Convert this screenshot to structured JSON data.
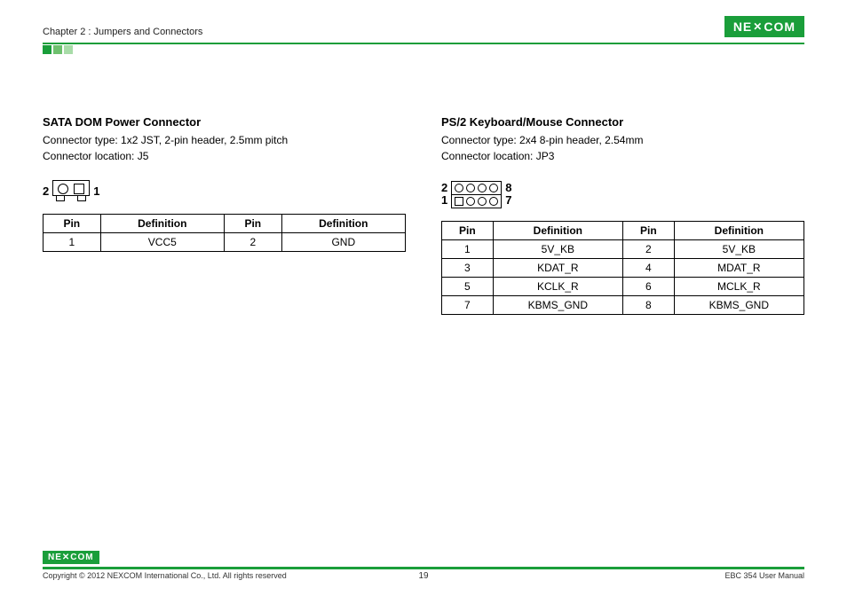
{
  "header": {
    "chapter": "Chapter 2 : Jumpers and Connectors",
    "logo": "NE✕COM"
  },
  "left": {
    "title": "SATA DOM Power Connector",
    "type_line": "Connector type: 1x2 JST, 2-pin header, 2.5mm pitch",
    "loc_line": "Connector location: J5",
    "diag_left_label": "2",
    "diag_right_label": "1",
    "th_pin": "Pin",
    "th_def": "Definition",
    "rows": [
      {
        "p1": "1",
        "d1": "VCC5",
        "p2": "2",
        "d2": "GND"
      }
    ]
  },
  "right": {
    "title": "PS/2 Keyboard/Mouse Connector",
    "type_line": "Connector type: 2x4 8-pin header, 2.54mm",
    "loc_line": "Connector location: JP3",
    "label_top_left": "2",
    "label_bot_left": "1",
    "label_top_right": "8",
    "label_bot_right": "7",
    "th_pin": "Pin",
    "th_def": "Definition",
    "rows": [
      {
        "p1": "1",
        "d1": "5V_KB",
        "p2": "2",
        "d2": "5V_KB"
      },
      {
        "p1": "3",
        "d1": "KDAT_R",
        "p2": "4",
        "d2": "MDAT_R"
      },
      {
        "p1": "5",
        "d1": "KCLK_R",
        "p2": "6",
        "d2": "MCLK_R"
      },
      {
        "p1": "7",
        "d1": "KBMS_GND",
        "p2": "8",
        "d2": "KBMS_GND"
      }
    ]
  },
  "footer": {
    "logo": "NE✕COM",
    "copyright": "Copyright © 2012 NEXCOM International Co., Ltd. All rights reserved",
    "page": "19",
    "manual": "EBC 354 User Manual"
  }
}
